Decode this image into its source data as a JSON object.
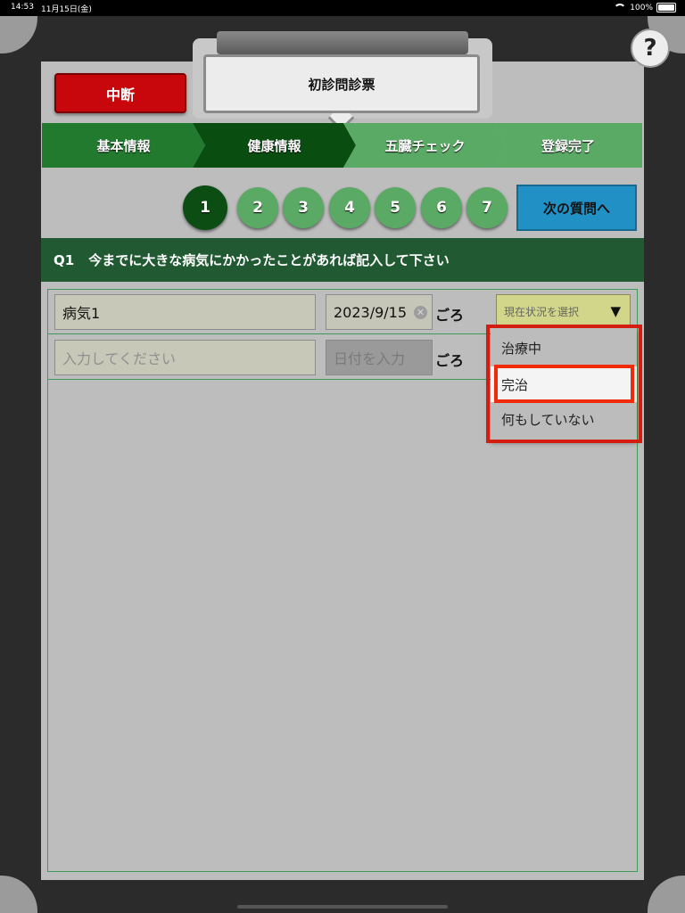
{
  "status_bar": {
    "time": "14:53",
    "date": "11月15日(金)",
    "battery": "100%"
  },
  "header": {
    "title": "初診問診票",
    "suspend_label": "中断",
    "help_label": "?"
  },
  "steps": [
    {
      "label": "基本情報",
      "color": "#217a2e"
    },
    {
      "label": "健康情報",
      "color": "#094d10"
    },
    {
      "label": "五臓チェック",
      "color": "#5aa965"
    },
    {
      "label": "登録完了",
      "color": "#5aa965"
    }
  ],
  "question_numbers": [
    {
      "label": "1",
      "color": "#0c4d13"
    },
    {
      "label": "2",
      "color": "#5aa965"
    },
    {
      "label": "3",
      "color": "#5aa965"
    },
    {
      "label": "4",
      "color": "#5aa965"
    },
    {
      "label": "5",
      "color": "#5aa965"
    },
    {
      "label": "6",
      "color": "#5aa965"
    },
    {
      "label": "7",
      "color": "#5aa965"
    }
  ],
  "next_button_label": "次の質問へ",
  "question": {
    "number": "Q1",
    "text": "今までに大きな病気にかかったことがあれば記入して下さい"
  },
  "rows": [
    {
      "illness_value": "病気1",
      "date_value": "2023/9/15",
      "suffix": "ごろ"
    },
    {
      "illness_placeholder": "入力してください",
      "date_placeholder": "日付を入力",
      "suffix": "ごろ"
    }
  ],
  "status_select": {
    "placeholder": "現在状況を選択",
    "arrow": "▼"
  },
  "dropdown_options": [
    "治療中",
    "完治",
    "何もしていない"
  ],
  "selected_option": "完治",
  "colors": {
    "accent_red": "#c8070c",
    "highlight": "#e0220d",
    "next_blue": "#2190c4",
    "question_bar": "#215a32"
  }
}
